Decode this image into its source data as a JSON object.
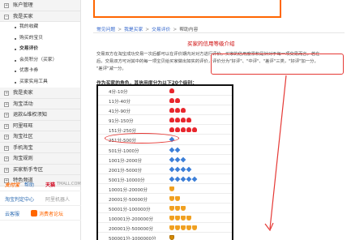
{
  "sidebar": {
    "sections": [
      {
        "label": "账户管理",
        "expanded": false
      },
      {
        "label": "我是买家",
        "expanded": true,
        "items": [
          "我的收藏",
          "购买的宝贝",
          "交易评价",
          "会员积分（买家）",
          "优惠卡券",
          "买家实用工具"
        ],
        "active_index": 2
      },
      {
        "label": "我是卖家",
        "expanded": false
      },
      {
        "label": "淘宝活动",
        "expanded": false
      },
      {
        "label": "退款&维权须知",
        "expanded": false
      },
      {
        "label": "阿里旺旺",
        "expanded": false
      },
      {
        "label": "淘宝社区",
        "expanded": false
      },
      {
        "label": "手机淘宝",
        "expanded": false
      },
      {
        "label": "淘宝规则",
        "expanded": false
      },
      {
        "label": "买家新手专区",
        "expanded": false
      },
      {
        "label": "特色频道",
        "expanded": false
      }
    ],
    "logos": {
      "alipay": "支付宝",
      "help": "帮助",
      "tmall": "天猫",
      "tmall_domain": "TMALL.COM",
      "judge_center": "淘宝判定中心",
      "anti_fraud": "阿里机器人",
      "yunke": "云客服",
      "consumer_forum": "消费者论坛"
    }
  },
  "breadcrumb": [
    "常见问题",
    "我是买家",
    "交易评价",
    "帮助内容"
  ],
  "article": {
    "title": "买家的信用等级介绍",
    "para_lines": [
      "交易双方在淘宝成功交易一次后都可以在评价期内对对方进行评价。买家的信用度累积是针对于每一项交易而言，若在",
      "后，交易双方可对其中的每一项宝贝给买家做出如实的评价，评价分为\"好评\"、\"中评\"、\"差评\"三类，\"好评\"加一分，",
      "\"差评\"减一分。"
    ],
    "level_intro": "作为买家的角色，其信用度分为以下20个级别："
  },
  "levels": [
    {
      "range": "4分-10分",
      "icon": "heart",
      "count": 1
    },
    {
      "range": "11分-40分",
      "icon": "heart",
      "count": 2
    },
    {
      "range": "41分-90分",
      "icon": "heart",
      "count": 3
    },
    {
      "range": "91分-150分",
      "icon": "heart",
      "count": 4
    },
    {
      "range": "151分-250分",
      "icon": "heart",
      "count": 5
    },
    {
      "range": "251分-500分",
      "icon": "diamond",
      "count": 1
    },
    {
      "range": "501分-1000分",
      "icon": "diamond",
      "count": 2
    },
    {
      "range": "1001分-2000分",
      "icon": "diamond",
      "count": 3
    },
    {
      "range": "2001分-5000分",
      "icon": "diamond",
      "count": 4
    },
    {
      "range": "5001分-10000分",
      "icon": "diamond",
      "count": 5
    },
    {
      "range": "10001分-20000分",
      "icon": "crown",
      "count": 1
    },
    {
      "range": "20001分-50000分",
      "icon": "crown",
      "count": 2
    },
    {
      "range": "50001分-100000分",
      "icon": "crown",
      "count": 3
    },
    {
      "range": "100001分-200000分",
      "icon": "crown",
      "count": 4
    },
    {
      "range": "200001分-500000分",
      "icon": "crown",
      "count": 5
    },
    {
      "range": "500001分-1000000分",
      "icon": "gcrown",
      "count": 1
    }
  ],
  "colors": {
    "accent": "#f60",
    "annotation": "#e53935",
    "link": "#3366cc",
    "title": "#c00"
  }
}
